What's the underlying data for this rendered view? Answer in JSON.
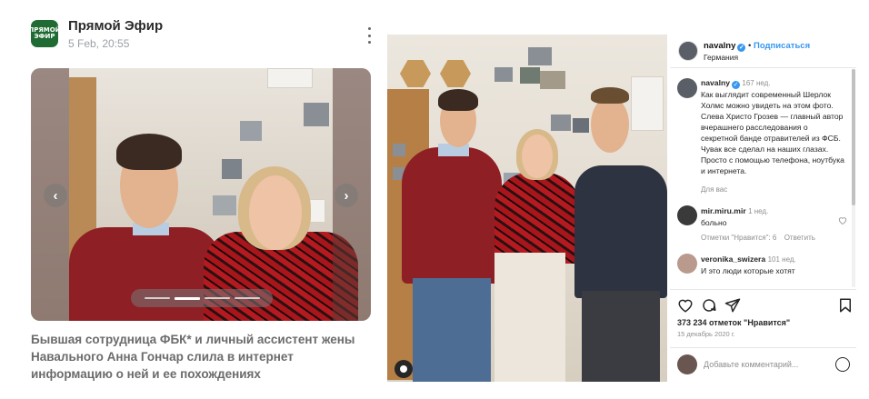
{
  "left_card": {
    "channel_name": "Прямой Эфир",
    "date": "5 Feb, 20:55",
    "avatar_text": "ПРЯМОЙ ЭФИР",
    "headline": "Бывшая сотрудница ФБК* и личный ассистент жены Навального Анна Гончар слила в интернет информацию о ней и ее похождениях",
    "prev_arrow": "‹",
    "next_arrow": "›",
    "slides_count": 4,
    "active_slide": 2
  },
  "instagram": {
    "username": "navalny",
    "follow_sep": "•",
    "follow_label": "Подписаться",
    "location": "Германия",
    "post": {
      "username": "navalny",
      "age": "167 нед.",
      "text": "Как выглядит современный Шерлок Холмс можно увидеть на этом фото. Слева Христо Грозев — главный автор вчерашнего расследования о секретной банде отравителей из ФСБ. Чувак все сделал на наших глазах. Просто с помощью телефона, ноутбука и интернета.",
      "translation_link": "Для вас"
    },
    "comments": [
      {
        "username": "mir.miru.mir",
        "age": "1 нед.",
        "text": "больно",
        "likes_label": "Отметки \"Нравится\": 6",
        "reply_label": "Ответить"
      },
      {
        "username": "veronika_swizera",
        "age": "101 нед.",
        "text": "И это люди которые хотят"
      }
    ],
    "likes": "373 234 отметок \"Нравится\"",
    "date": "15 декабрь 2020 г.",
    "add_comment_placeholder": "Добавьте комментарий..."
  },
  "colors": {
    "accent_blue": "#3897f0",
    "channel_green": "#1f6b33",
    "headline_gray": "#6b6b6b"
  },
  "icons": [
    "kebab-menu-icon",
    "chevron-left-icon",
    "chevron-right-icon",
    "verified-badge-icon",
    "heart-icon",
    "comment-icon",
    "share-icon",
    "bookmark-icon",
    "user-tag-icon",
    "emoji-icon"
  ]
}
